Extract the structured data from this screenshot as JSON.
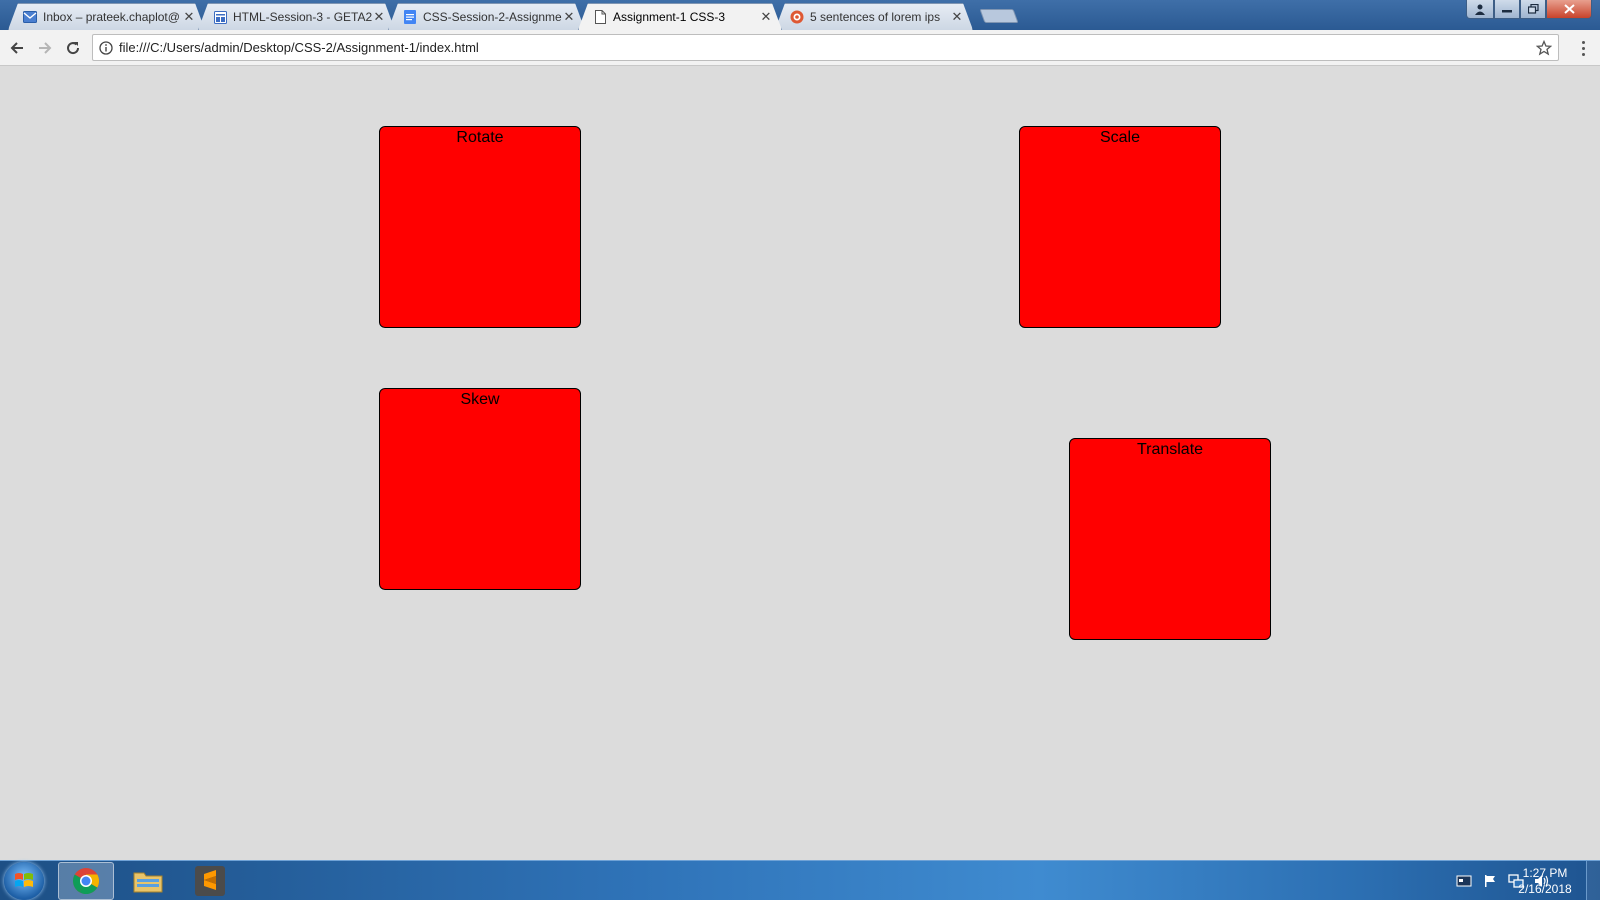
{
  "browser": {
    "tabs": [
      {
        "title": "Inbox – prateek.chaplot@",
        "icon": "inbox-icon"
      },
      {
        "title": "HTML-Session-3 - GETA2",
        "icon": "slides-icon"
      },
      {
        "title": "CSS-Session-2-Assignme",
        "icon": "docs-icon"
      },
      {
        "title": "Assignment-1 CSS-3",
        "icon": "page-icon",
        "active": true
      },
      {
        "title": "5 sentences of lorem ips",
        "icon": "lorem-icon"
      }
    ],
    "url": "file:///C:/Users/admin/Desktop/CSS-2/Assignment-1/index.html"
  },
  "page": {
    "boxes": {
      "rotate": "Rotate",
      "scale": "Scale",
      "skew": "Skew",
      "translate": "Translate"
    },
    "box_color": "#ff0000",
    "background": "#dcdcdc"
  },
  "taskbar": {
    "time": "1:27 PM",
    "date": "2/16/2018"
  }
}
